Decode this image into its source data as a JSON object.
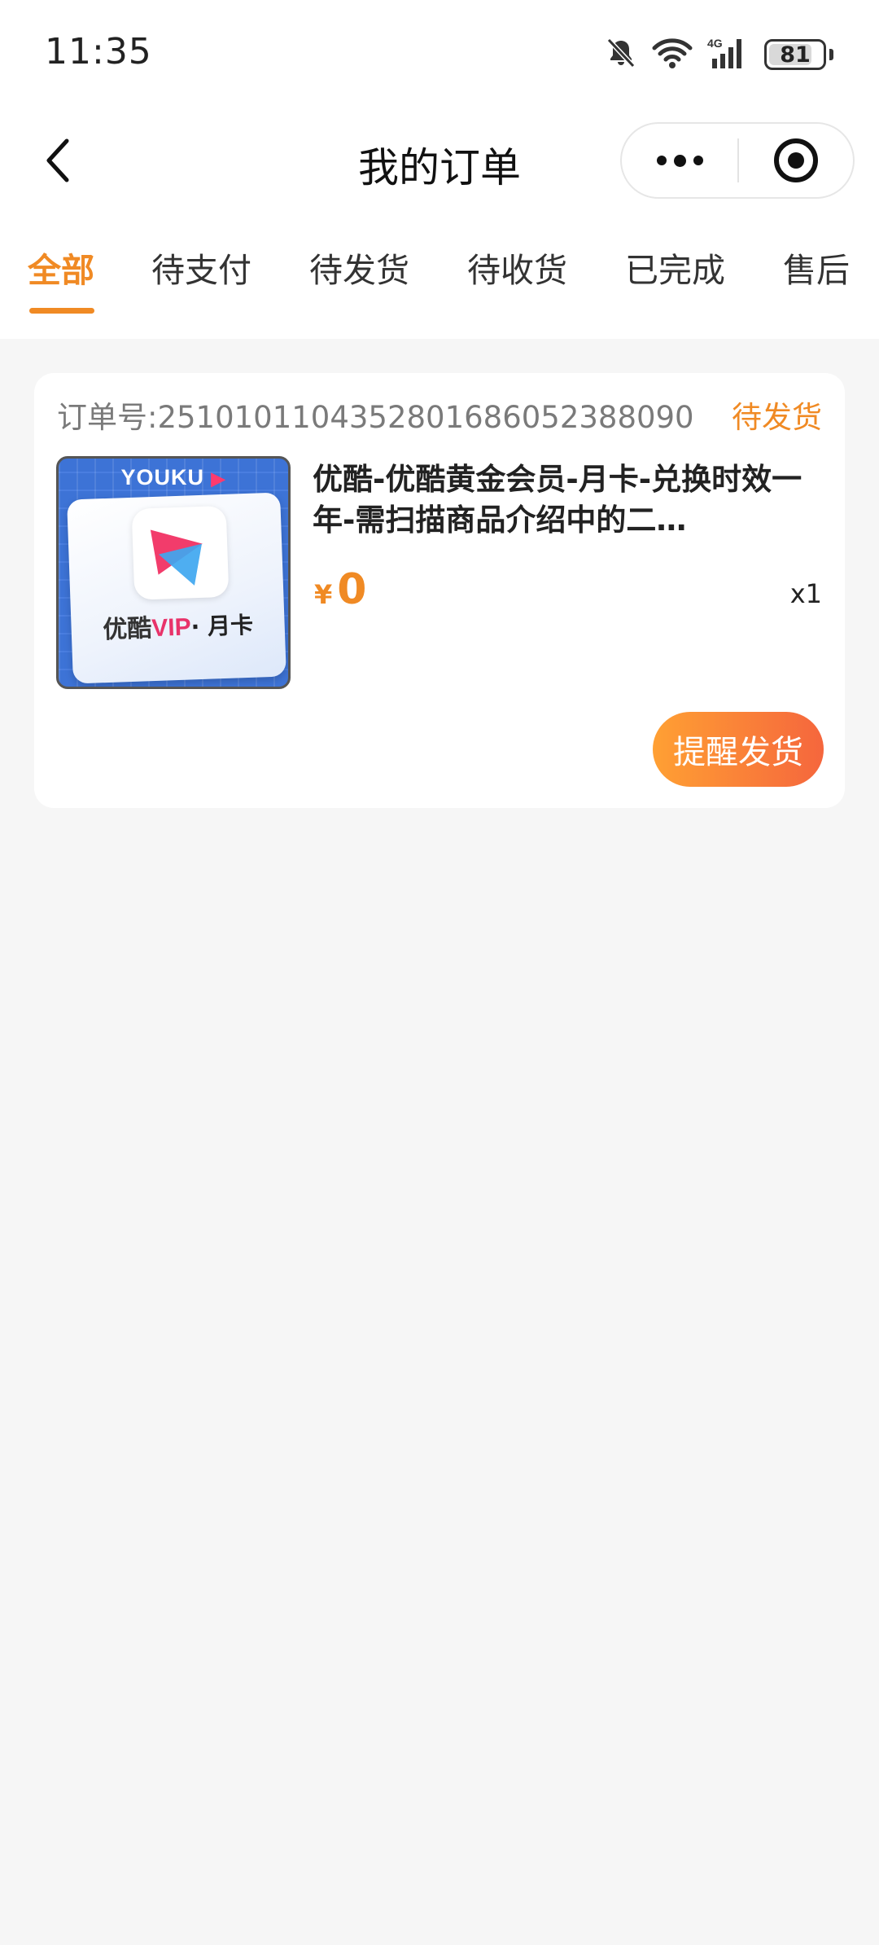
{
  "status_bar": {
    "time": "11:35",
    "battery_level": "81",
    "battery_fraction": 0.81,
    "network": "4G",
    "icons": [
      "bell-off-icon",
      "wifi-icon",
      "signal-4g-icon",
      "battery-icon"
    ]
  },
  "nav": {
    "title": "我的订单",
    "back_icon": "chevron-left-icon",
    "more_icon": "more-dots-icon",
    "close_icon": "target-circle-icon"
  },
  "tabs": [
    {
      "label": "全部",
      "active": true
    },
    {
      "label": "待支付",
      "active": false
    },
    {
      "label": "待发货",
      "active": false
    },
    {
      "label": "待收货",
      "active": false
    },
    {
      "label": "已完成",
      "active": false
    },
    {
      "label": "售后",
      "active": false
    }
  ],
  "orders": [
    {
      "order_no_label": "订单号:2510101104352801686052388090",
      "status": "待发货",
      "product": {
        "title": "优酷-优酷黄金会员-月卡-兑换时效一年-需扫描商品介绍中的二…",
        "thumb_brand": "YOUKU",
        "thumb_caption_prefix": "优酷",
        "thumb_caption_vip": "VIP",
        "thumb_caption_suffix": "· 月卡"
      },
      "price_currency": "¥",
      "price_amount": "0",
      "quantity": "x1",
      "action_label": "提醒发货"
    }
  ],
  "colors": {
    "accent": "#f08a24",
    "button_gradient_start": "#ffa033",
    "button_gradient_end": "#f5663d",
    "page_bg": "#f6f6f6"
  }
}
